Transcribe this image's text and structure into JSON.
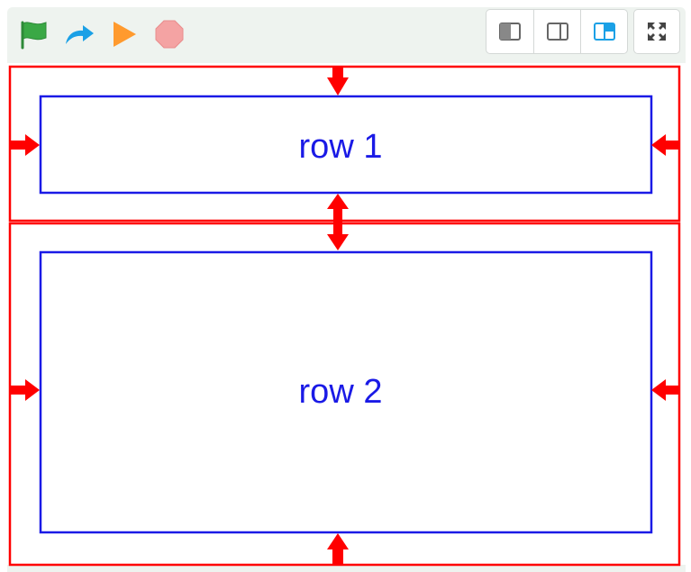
{
  "toolbar": {
    "left_buttons": [
      {
        "icon": "green-flag-icon",
        "label": "",
        "color": "#3aa845"
      },
      {
        "icon": "step-icon",
        "label": "",
        "color": "#1aa0e6"
      },
      {
        "icon": "play-icon",
        "label": "",
        "color": "#ff9a2e"
      },
      {
        "icon": "stop-icon",
        "label": "",
        "color": "#f4a3a3"
      }
    ],
    "layout_buttons": [
      {
        "icon": "layout-left-panel-icon",
        "active": false
      },
      {
        "icon": "layout-right-panel-icon",
        "active": false
      },
      {
        "icon": "layout-top-left-panel-icon",
        "active": true
      }
    ],
    "fullscreen_icon": "fullscreen-icon"
  },
  "diagram": {
    "rows": [
      {
        "label": "row 1"
      },
      {
        "label": "row 2"
      }
    ],
    "colors": {
      "outer": "#ff0000",
      "inner": "#1a1ae6",
      "arrow": "#ff0000"
    }
  }
}
